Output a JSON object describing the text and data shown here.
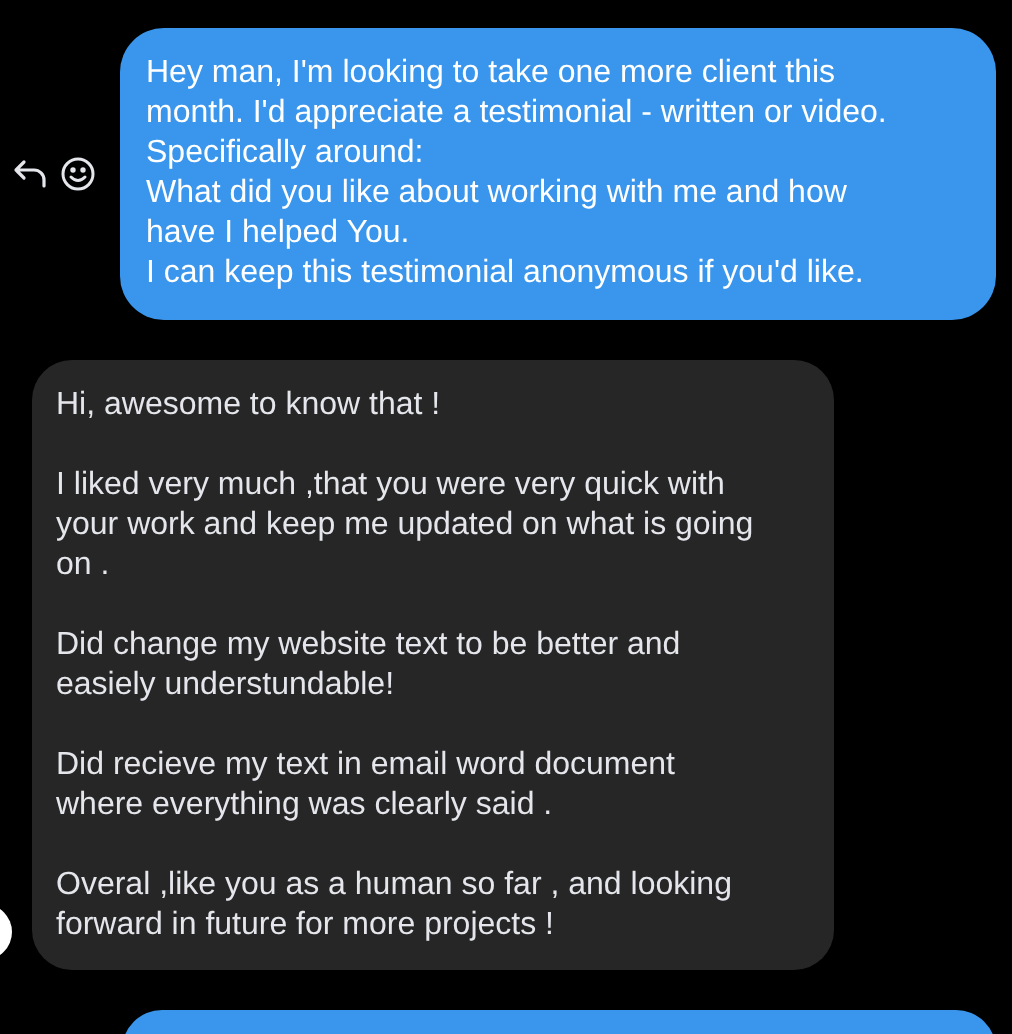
{
  "messages": [
    {
      "kind": "sent",
      "paragraphs": [
        {
          "lines": [
            "Hey man, I'm looking to take one more client this",
            "month. I'd appreciate a testimonial - written or video.",
            "Specifically around:",
            "What did you like about working with me and how",
            "have I helped You.",
            "I can keep this testimonial anonymous if you'd like."
          ]
        }
      ]
    },
    {
      "kind": "received",
      "paragraphs": [
        {
          "lines": [
            "Hi, awesome to know that !"
          ]
        },
        {
          "lines": [
            "I liked very much ,that you were very quick with",
            "your work and keep me updated on what is going",
            "on ."
          ]
        },
        {
          "lines": [
            "Did change my website text to be better and",
            "easiely understundable!"
          ]
        },
        {
          "lines": [
            "Did recieve my text in email word document",
            "where everything was clearly said ."
          ]
        },
        {
          "lines": [
            "Overal ,like you as a human so far , and looking",
            "forward in future for more projects !"
          ]
        }
      ]
    },
    {
      "kind": "sent"
    }
  ]
}
